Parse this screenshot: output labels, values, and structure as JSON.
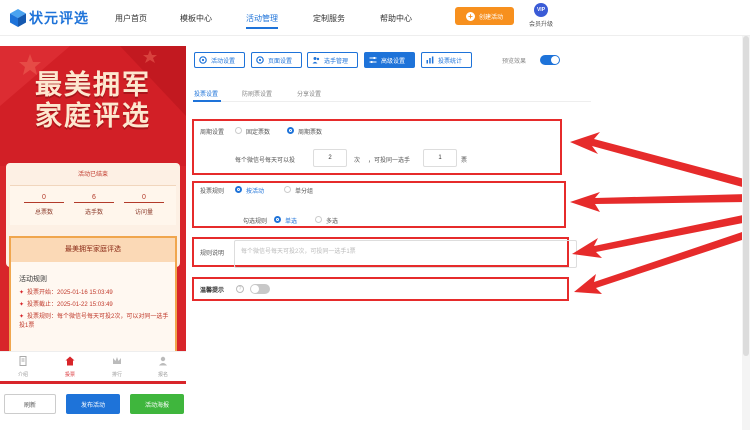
{
  "brand": {
    "name": "状元评选",
    "color": "#1e73d9"
  },
  "nav": {
    "items": [
      {
        "label": "用户首页"
      },
      {
        "label": "模板中心"
      },
      {
        "label": "活动管理"
      },
      {
        "label": "定制服务"
      },
      {
        "label": "帮助中心"
      }
    ],
    "active": "活动管理",
    "create_label": "创建活动",
    "vip_badge": "VIP",
    "vip_label": "会员升级"
  },
  "preview": {
    "hero_line1": "最美拥军",
    "hero_line2": "家庭评选",
    "status": "活动已结束",
    "stats": [
      {
        "value": "0",
        "label": "总票数"
      },
      {
        "value": "6",
        "label": "选手数"
      },
      {
        "value": "0",
        "label": "访问量"
      }
    ],
    "card_title": "最美拥军家庭评选",
    "rules_heading": "活动规则",
    "rules": [
      "投票开始：2025-01-16 15:03:49",
      "投票截止：2025-01-22 15:03:49",
      "投票规则：每个微信号每天可投2次，可以对同一选手投1票"
    ],
    "bottom_nav": [
      "介绍",
      "投票",
      "排行",
      "报名"
    ],
    "bottom_nav_active": "投票",
    "theme_color": "#d8252a"
  },
  "actions": {
    "refresh": "刷新",
    "publish": "发布活动",
    "poster": "活动海报"
  },
  "toolbar": {
    "buttons": [
      "活动设置",
      "页面设置",
      "选手管理",
      "高级设置",
      "投票统计"
    ],
    "active": "高级设置",
    "preview_effect_label": "预览效果",
    "preview_effect_on": true
  },
  "subtabs": {
    "items": [
      "投票设置",
      "防刷票设置",
      "分享设置"
    ],
    "active": "投票设置"
  },
  "form": {
    "cycle": {
      "label": "周期设置",
      "options": [
        "固定票数",
        "周期票数"
      ],
      "selected": "周期票数",
      "text_prefix": "每个微信号每天可以投",
      "votes_per_day": "2",
      "text_unit": "次",
      "text_mid": "，可投同一选手",
      "votes_same": "1",
      "text_suffix": "票"
    },
    "rule": {
      "label": "投票规则",
      "options": [
        "按活动",
        "单分组"
      ],
      "selected": "按活动",
      "select_label": "勾选规则",
      "select_options": [
        "单选",
        "多选"
      ],
      "select_selected": "单选"
    },
    "desc": {
      "label": "规则说明",
      "placeholder": "每个微信号每天可投2次，可投同一选手1票"
    },
    "tip": {
      "label": "温馨提示",
      "help": "?",
      "enabled": false
    }
  },
  "annotation_color": "#e62b2b"
}
